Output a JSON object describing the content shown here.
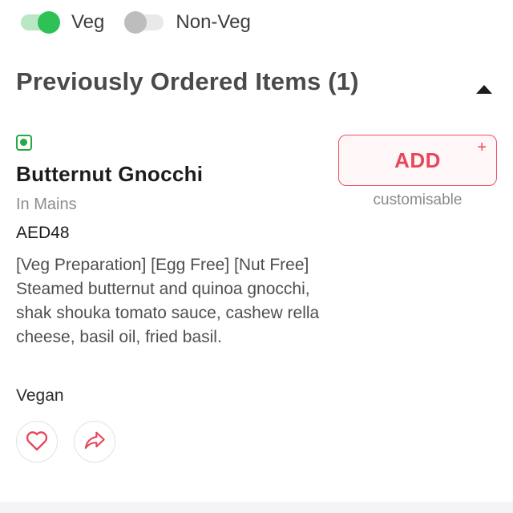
{
  "filters": {
    "veg": {
      "label": "Veg",
      "enabled": true
    },
    "non_veg": {
      "label": "Non-Veg",
      "enabled": false
    }
  },
  "section": {
    "title": "Previously Ordered Items (1)",
    "expanded": true
  },
  "item": {
    "name": "Butternut Gnocchi",
    "category": "In Mains",
    "price": "AED48",
    "description": "[Veg Preparation] [Egg Free] [Nut Free] Steamed butternut and quinoa gnocchi, shak shouka tomato sauce, cashew rella cheese, basil oil, fried basil.",
    "tag": "Vegan",
    "add_label": "ADD",
    "add_plus": "+",
    "customisable_label": "customisable",
    "diet_indicator": "veg-icon"
  },
  "icons": {
    "favourite": "heart-icon",
    "share": "share-icon",
    "collapse": "caret-up-icon"
  },
  "colors": {
    "accent": "#e5485a",
    "veg_green": "#2dc156",
    "muted_text": "#8c8c8c"
  }
}
